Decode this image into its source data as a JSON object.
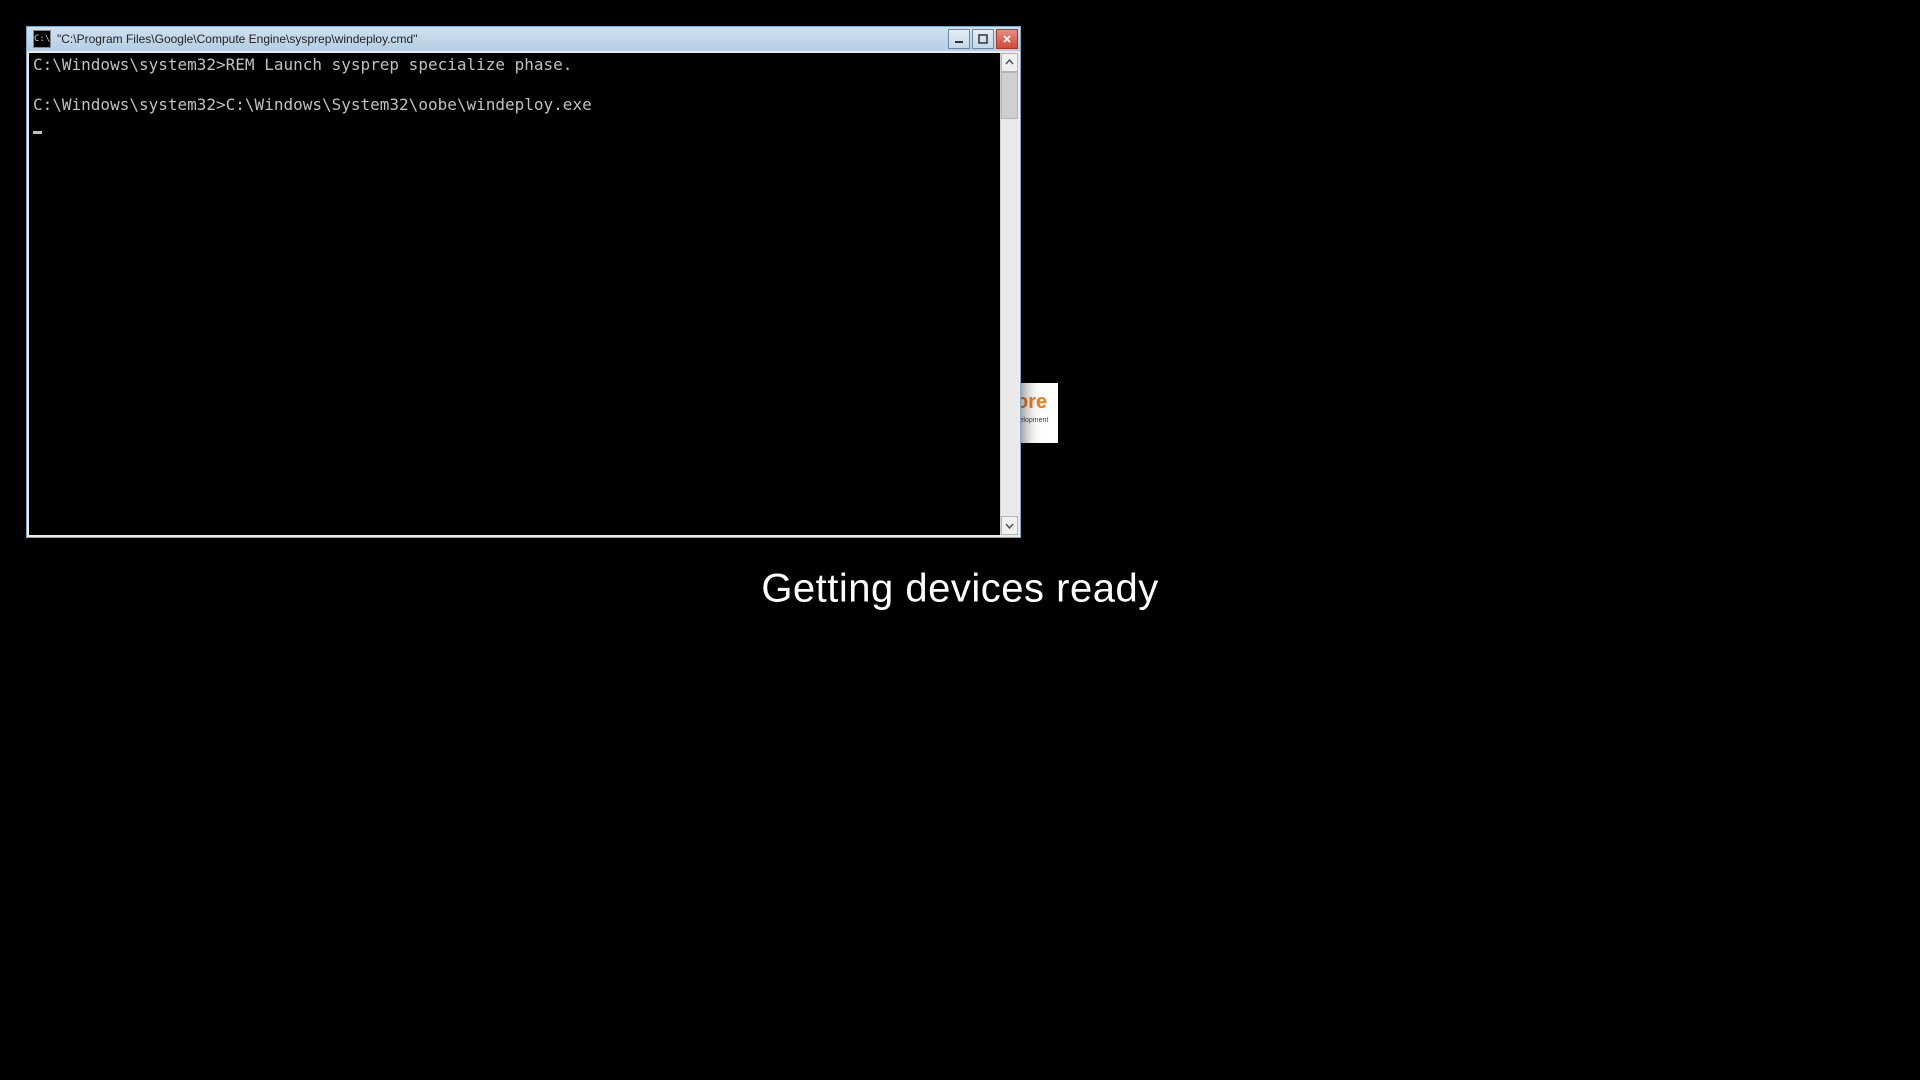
{
  "oobe": {
    "message": "Getting devices ready"
  },
  "bgwin": {
    "logo_fragment": "ore",
    "logo_sub_fragment": "velopment"
  },
  "cmd": {
    "title": "\"C:\\Program Files\\Google\\Compute Engine\\sysprep\\windeploy.cmd\"",
    "lines": [
      "C:\\Windows\\system32>REM Launch sysprep specialize phase.",
      "",
      "C:\\Windows\\system32>C:\\Windows\\System32\\oobe\\windeploy.exe"
    ],
    "icon_label": "C:\\"
  }
}
